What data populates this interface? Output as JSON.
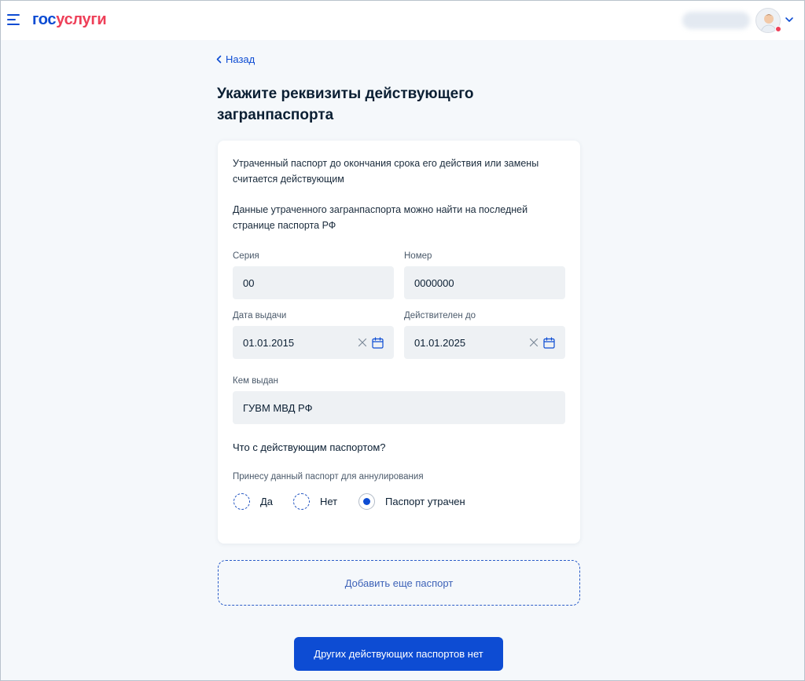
{
  "header": {
    "logo_part1": "гос",
    "logo_part2": "услуги"
  },
  "back": {
    "label": "Назад"
  },
  "title": "Укажите реквизиты действующего загранпаспорта",
  "notes": {
    "n1": "Утраченный паспорт до окончания срока его действия или замены считается действующим",
    "n2": "Данные утраченного загранпаспорта можно найти на последней странице паспорта РФ"
  },
  "fields": {
    "series": {
      "label": "Серия",
      "value": "00"
    },
    "number": {
      "label": "Номер",
      "value": "0000000"
    },
    "issue_date": {
      "label": "Дата выдачи",
      "value": "01.01.2015"
    },
    "valid_until": {
      "label": "Действителен до",
      "value": "01.01.2025"
    },
    "issued_by": {
      "label": "Кем выдан",
      "value": "ГУВМ МВД РФ"
    }
  },
  "question": {
    "title": "Что с действующим паспортом?",
    "subtitle": "Принесу данный паспорт для аннулирования",
    "options": [
      "Да",
      "Нет",
      "Паспорт утрачен"
    ],
    "selected": "Паспорт утрачен"
  },
  "buttons": {
    "add": "Добавить еще паспорт",
    "primary": "Других действующих паспортов нет"
  },
  "colors": {
    "accent": "#0d4cd3",
    "logo_red": "#ee3f58",
    "background": "#f5f8fb",
    "field_bg": "#eef1f4"
  },
  "icons": [
    "menu-icon",
    "user-avatar",
    "chevron-down-icon",
    "chevron-left-icon",
    "clear-icon",
    "calendar-icon"
  ]
}
